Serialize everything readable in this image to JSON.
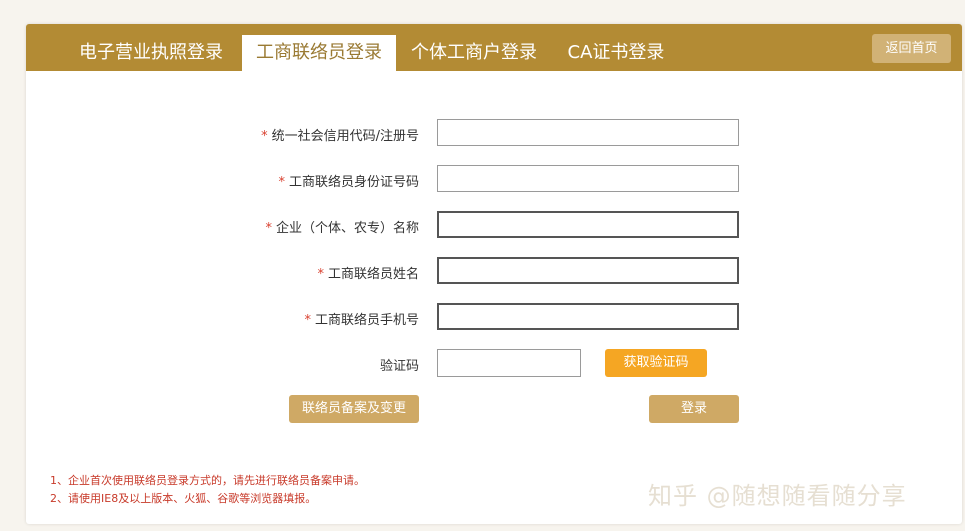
{
  "tabs": [
    {
      "label": "电子营业执照登录",
      "active": false
    },
    {
      "label": "工商联络员登录",
      "active": true
    },
    {
      "label": "个体工商户登录",
      "active": false
    },
    {
      "label": "CA证书登录",
      "active": false
    }
  ],
  "home_button": "返回首页",
  "form": {
    "required_mark": "*",
    "fields": [
      {
        "label": "统一社会信用代码/注册号",
        "required": true,
        "value": ""
      },
      {
        "label": "工商联络员身份证号码",
        "required": true,
        "value": ""
      },
      {
        "label": "企业（个体、农专）名称",
        "required": true,
        "value": ""
      },
      {
        "label": "工商联络员姓名",
        "required": true,
        "value": ""
      },
      {
        "label": "工商联络员手机号",
        "required": true,
        "value": ""
      }
    ],
    "captcha_label": "验证码",
    "captcha_value": "",
    "get_code_button": "获取验证码",
    "register_button": "联络员备案及变更",
    "login_button": "登录"
  },
  "notes": [
    "1、企业首次使用联络员登录方式的，请先进行联络员备案申请。",
    "2、请使用IE8及以上版本、火狐、谷歌等浏览器填报。"
  ],
  "watermark": "知乎 @随想随看随分享",
  "colors": {
    "header": "#b38b34",
    "accent_orange": "#f5a623",
    "tan_button": "#cfa965",
    "note_red": "#c83a2a"
  }
}
